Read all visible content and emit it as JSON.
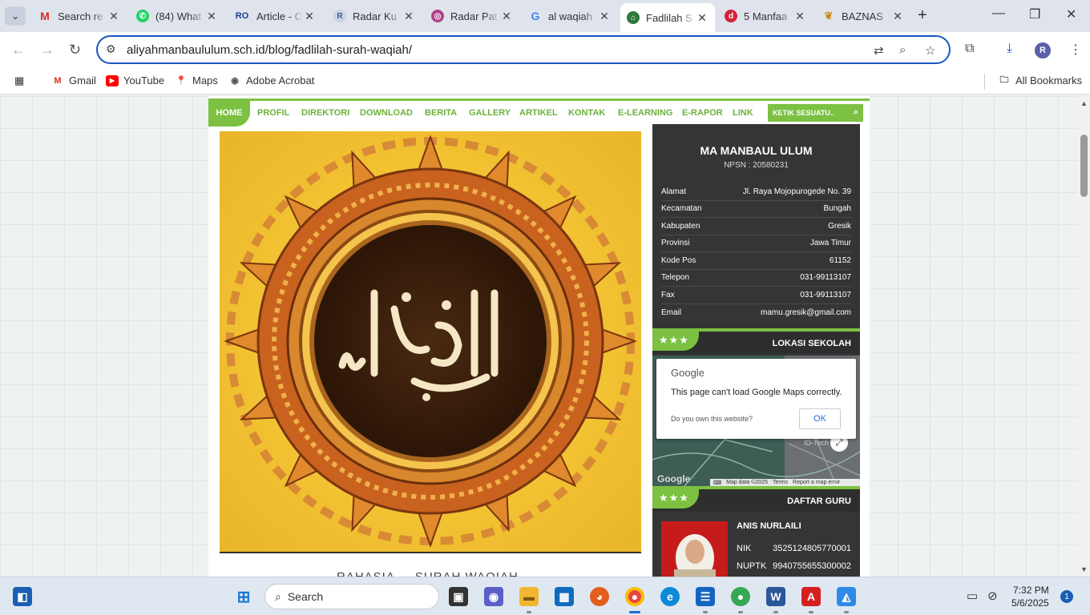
{
  "tabs": [
    {
      "title": "Search re",
      "favicon": "gmail-icon",
      "active": false
    },
    {
      "title": "(84) What",
      "favicon": "whatsapp-icon",
      "active": false
    },
    {
      "title": "Article - C",
      "favicon": "ro-icon",
      "active": false
    },
    {
      "title": "Radar Ku",
      "favicon": "radar-icon",
      "active": false
    },
    {
      "title": "Radar Pat",
      "favicon": "radar-pat-icon",
      "active": false
    },
    {
      "title": "al waqiah",
      "favicon": "google-icon",
      "active": false
    },
    {
      "title": "Fadlilah S",
      "favicon": "site-icon",
      "active": true
    },
    {
      "title": "5 Manfaa",
      "favicon": "d-icon",
      "active": false
    },
    {
      "title": "BAZNAS",
      "favicon": "baznas-icon",
      "active": false
    }
  ],
  "address_bar": {
    "url": "aliyahmanbaululum.sch.id/blog/fadlilah-surah-waqiah/"
  },
  "bookmarks": [
    {
      "label": "Gmail",
      "icon": "gmail-icon"
    },
    {
      "label": "YouTube",
      "icon": "youtube-icon"
    },
    {
      "label": "Maps",
      "icon": "maps-icon"
    },
    {
      "label": "Adobe Acrobat",
      "icon": "acrobat-icon"
    }
  ],
  "all_bookmarks": "All Bookmarks",
  "site_nav": {
    "items": [
      "HOME",
      "PROFIL",
      "DIREKTORI",
      "DOWNLOAD",
      "BERITA",
      "GALLERY",
      "ARTIKEL",
      "KONTAK",
      "E-LEARNING",
      "E-RAPOR",
      "LINK"
    ],
    "search_placeholder": "KETIK SESUATU.."
  },
  "article": {
    "caption": "RAHASIA ... SURAH WAQIAH"
  },
  "school": {
    "name": "MA MANBAUL ULUM",
    "npsn": "NPSN : 20580231",
    "info": [
      {
        "label": "Alamat",
        "value": "Jl. Raya Mojopurogede No. 39"
      },
      {
        "label": "Kecamatan",
        "value": "Bungah"
      },
      {
        "label": "Kabupaten",
        "value": "Gresik"
      },
      {
        "label": "Provinsi",
        "value": "Jawa Timur"
      },
      {
        "label": "Kode Pos",
        "value": "61152"
      },
      {
        "label": "Telepon",
        "value": "031-99113107"
      },
      {
        "label": "Fax",
        "value": "031-99113107"
      },
      {
        "label": "Email",
        "value": "mamu.gresik@gmail.com"
      }
    ]
  },
  "location_widget": {
    "title": "LOKASI SEKOLAH",
    "stars": "★★★",
    "dialog_logo": "Google",
    "dialog_message": "This page can't load Google Maps correctly.",
    "dialog_question": "Do you own this website?",
    "dialog_ok": "OK",
    "map_label": "ID-Tech",
    "footer_google": "Google",
    "footer_data": "Map data ©2025",
    "footer_terms": "Terms",
    "footer_report": "Report a map error"
  },
  "teacher_widget": {
    "title": "DAFTAR GURU",
    "stars": "★★★",
    "name": "ANIS NURLAILI",
    "nik_label": "NIK",
    "nik": "3525124805770001",
    "nuptk_label": "NUPTK",
    "nuptk": "9940755655300002"
  },
  "taskbar": {
    "search_label": "Search",
    "time": "7:32 PM",
    "date": "5/6/2025",
    "notifications": "1"
  },
  "colors": {
    "accent_green": "#7cc142",
    "sidebar_dark": "#353535",
    "chrome_blue": "#1a56c4"
  }
}
